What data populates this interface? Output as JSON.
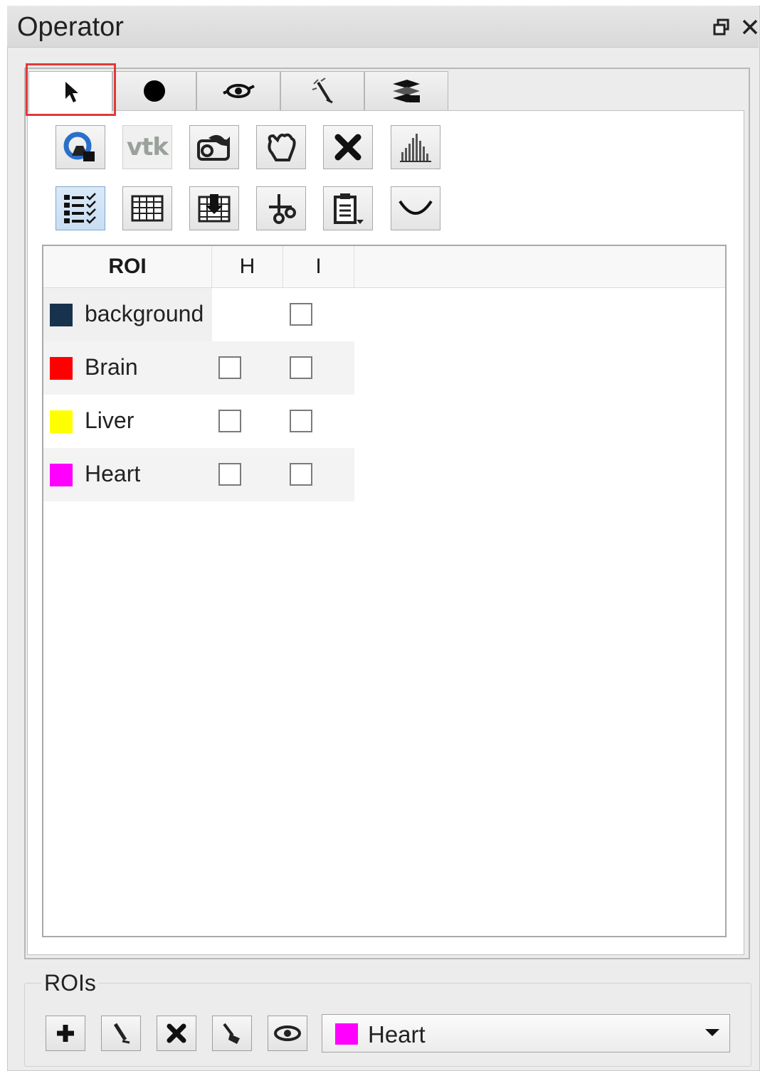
{
  "window": {
    "title": "Operator"
  },
  "tabs": [
    {
      "icon": "cursor-arrow-icon",
      "selected": true
    },
    {
      "icon": "filled-circle-icon",
      "selected": false
    },
    {
      "icon": "eye-brush-icon",
      "selected": false
    },
    {
      "icon": "magic-wand-icon",
      "selected": false
    },
    {
      "icon": "layers-icon",
      "selected": false
    }
  ],
  "toolbar": {
    "row1": [
      "snapshot-icon",
      "vtk",
      "rotate-3d-icon",
      "hand-pan-icon",
      "delete-icon",
      "histogram-icon"
    ],
    "row2": [
      "checklist-icon",
      "table-icon",
      "download-icon",
      "scissors-icon",
      "clipboard-icon",
      "curve-icon"
    ],
    "vtk_label": "vtk"
  },
  "roi_table": {
    "headers": {
      "roi": "ROI",
      "h": "H",
      "i": "I"
    },
    "rows": [
      {
        "name": "background",
        "color": "#17324d",
        "h_checkbox": false,
        "i_checked": false
      },
      {
        "name": "Brain",
        "color": "#ff0000",
        "h_checkbox": true,
        "h_checked": false,
        "i_checked": false
      },
      {
        "name": "Liver",
        "color": "#ffff00",
        "h_checkbox": true,
        "h_checked": false,
        "i_checked": false
      },
      {
        "name": "Heart",
        "color": "#ff00ff",
        "h_checkbox": true,
        "h_checked": false,
        "i_checked": false
      }
    ]
  },
  "rois_group": {
    "label": "ROIs",
    "buttons": [
      "add-icon",
      "edit-pencil-icon",
      "delete-icon",
      "brush-icon",
      "eye-icon"
    ],
    "selected_roi": {
      "name": "Heart",
      "color": "#ff00ff"
    }
  },
  "colors": {
    "highlight_border": "#e0393c"
  }
}
